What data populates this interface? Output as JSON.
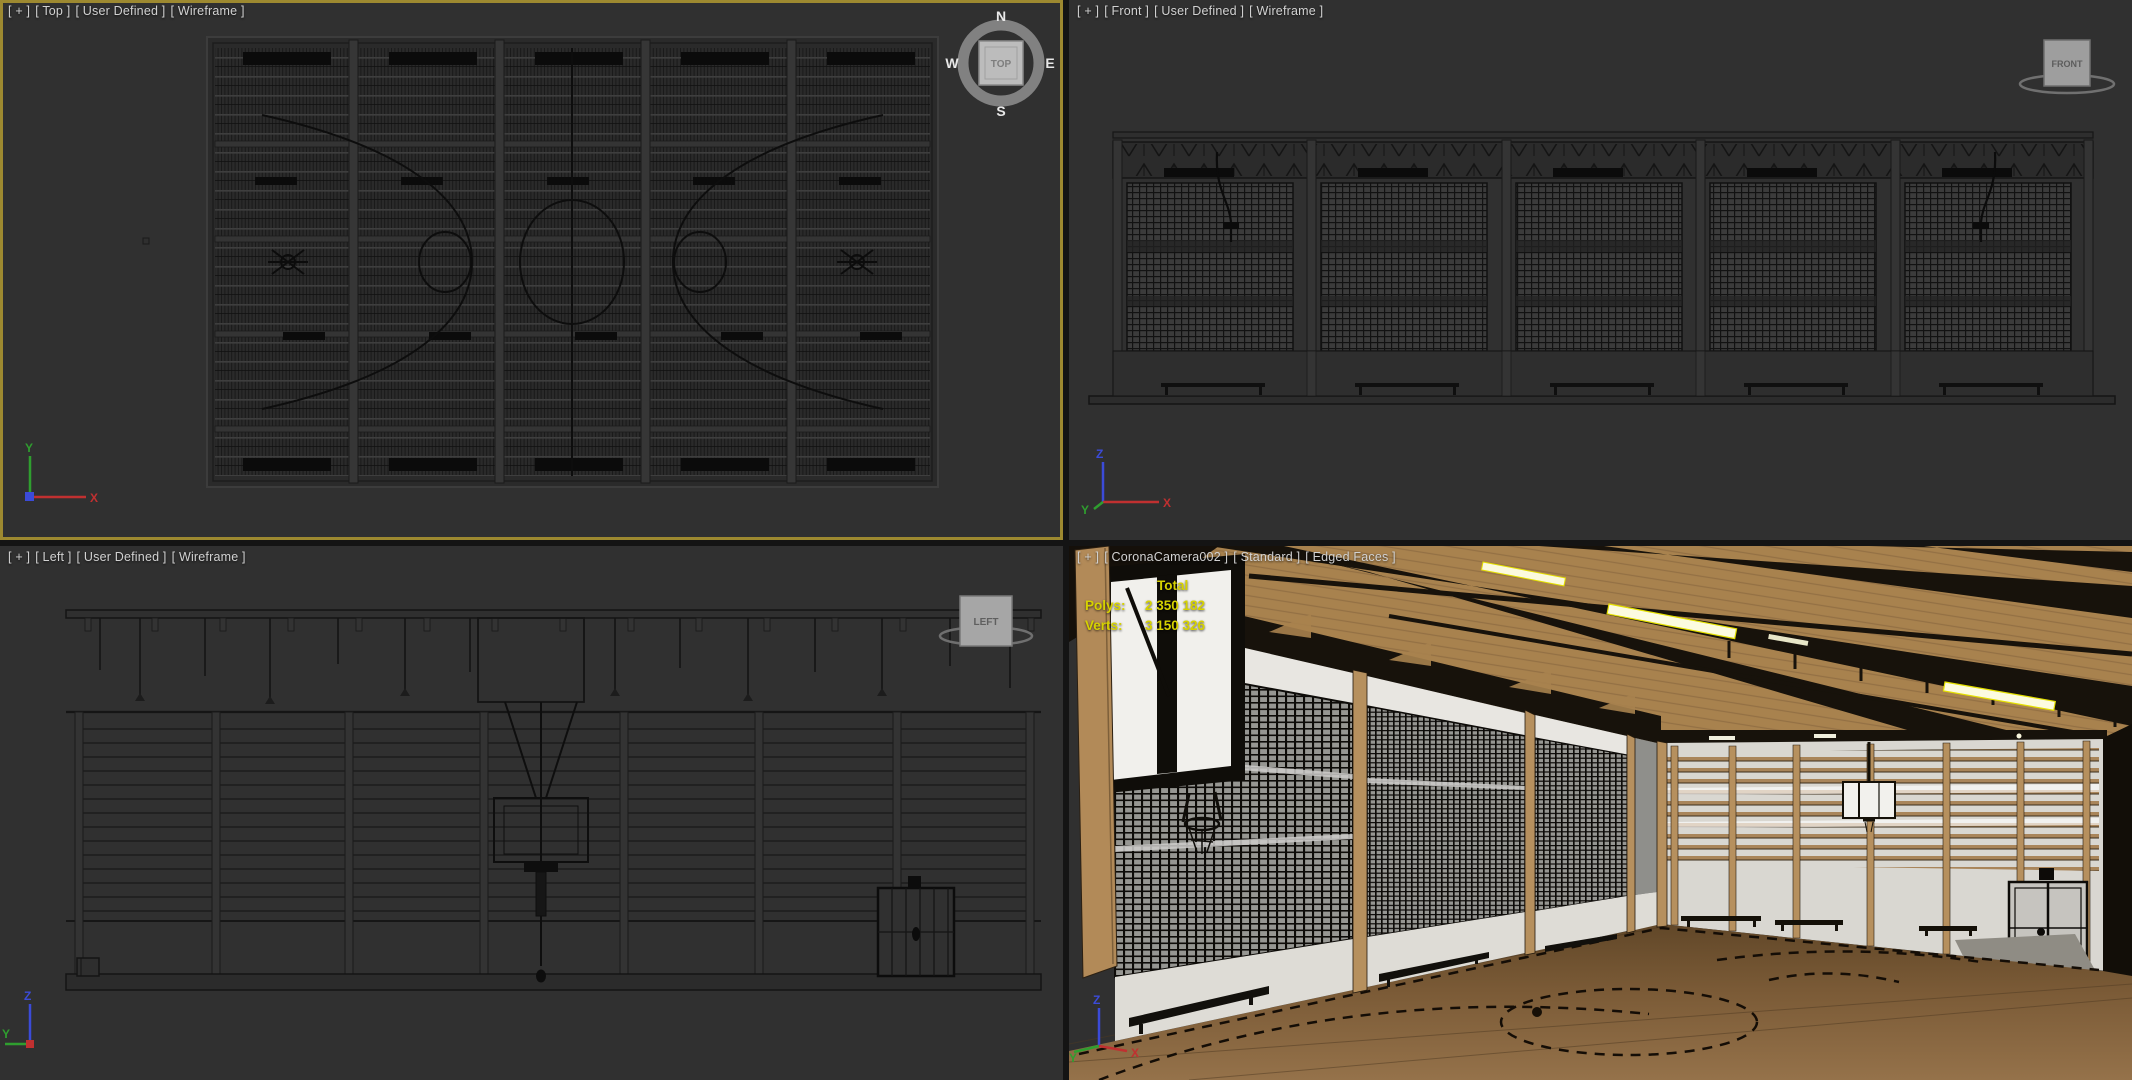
{
  "viewports": {
    "top": {
      "label": {
        "plus": "[ + ]",
        "view": "[ Top ]",
        "pov": "[ User Defined ]",
        "shading": "[ Wireframe ]"
      },
      "viewcube": {
        "face": "TOP",
        "compass": {
          "n": "N",
          "e": "E",
          "s": "S",
          "w": "W"
        }
      }
    },
    "front": {
      "label": {
        "plus": "[ + ]",
        "view": "[ Front ]",
        "pov": "[ User Defined ]",
        "shading": "[ Wireframe ]"
      },
      "viewcube": {
        "face": "FRONT"
      }
    },
    "left": {
      "label": {
        "plus": "[ + ]",
        "view": "[ Left ]",
        "pov": "[ User Defined ]",
        "shading": "[ Wireframe ]"
      },
      "viewcube": {
        "face": "LEFT"
      }
    },
    "camera": {
      "label": {
        "plus": "[ + ]",
        "view": "[ CoronaCamera002 ]",
        "pov": "[ Standard ]",
        "shading": "[ Edged Faces ]"
      },
      "stats": {
        "title": "Total",
        "rows": [
          {
            "label": "Polys:",
            "value": "2 350 182"
          },
          {
            "label": "Verts:",
            "value": "3 150 326"
          }
        ]
      }
    }
  },
  "axis_labels": {
    "x": "X",
    "y": "Y",
    "z": "Z"
  },
  "colors": {
    "active_viewport_border": "#9d8930",
    "viewport_background": "#303030",
    "label_text": "#d2d2d2",
    "stats_text": "#d6d200",
    "axis_x": "#c03030",
    "axis_y": "#2f9e2f",
    "axis_z": "#3b4bd8",
    "wireframe_line": "#101010",
    "floor_wood": "#7d5d39",
    "ceiling_wood": "#a8824e",
    "truss_dark": "#17120b",
    "wall_white": "#dedcd6"
  }
}
